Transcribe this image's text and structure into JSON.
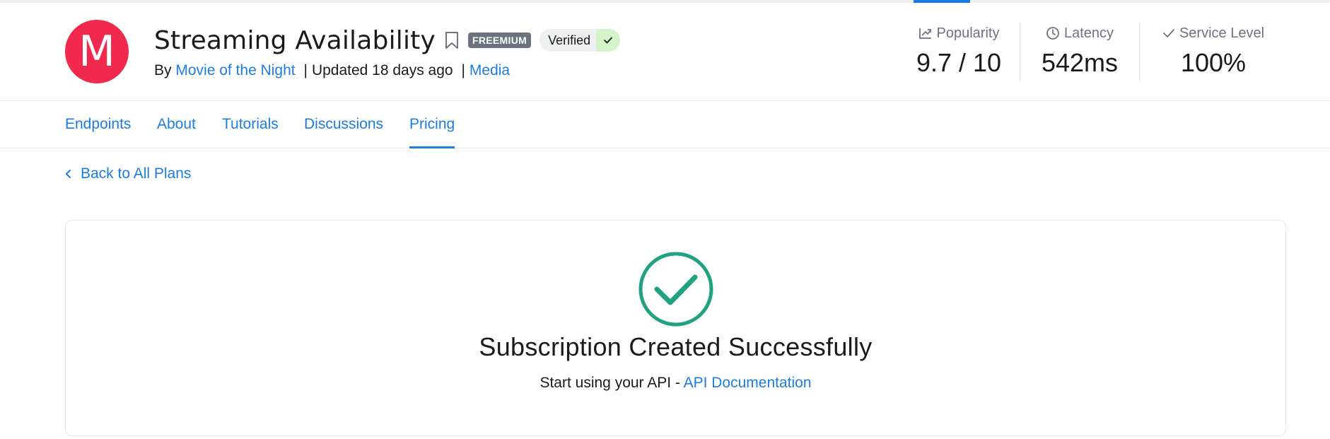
{
  "header": {
    "avatar_letter": "M",
    "title": "Streaming Availability",
    "badge": "FREEMIUM",
    "verified_label": "Verified",
    "byline_prefix": "By",
    "provider": "Movie of the Night",
    "updated": "Updated 18 days ago",
    "category": "Media",
    "separator": "|"
  },
  "stats": [
    {
      "label": "Popularity",
      "value": "9.7 / 10",
      "icon": "trend-icon"
    },
    {
      "label": "Latency",
      "value": "542ms",
      "icon": "clock-icon"
    },
    {
      "label": "Service Level",
      "value": "100%",
      "icon": "check-icon"
    }
  ],
  "tabs": [
    {
      "label": "Endpoints",
      "active": false
    },
    {
      "label": "About",
      "active": false
    },
    {
      "label": "Tutorials",
      "active": false
    },
    {
      "label": "Discussions",
      "active": false
    },
    {
      "label": "Pricing",
      "active": true
    }
  ],
  "back_link": "Back to All Plans",
  "success": {
    "title": "Subscription Created Successfully",
    "subtitle_prefix": "Start using your API - ",
    "doc_link": "API Documentation"
  },
  "colors": {
    "accent": "#1c7ce0",
    "avatar": "#f2294e",
    "success": "#1fa182",
    "verified_bg": "#d5f3c8",
    "badge_bg": "#6b7280"
  }
}
